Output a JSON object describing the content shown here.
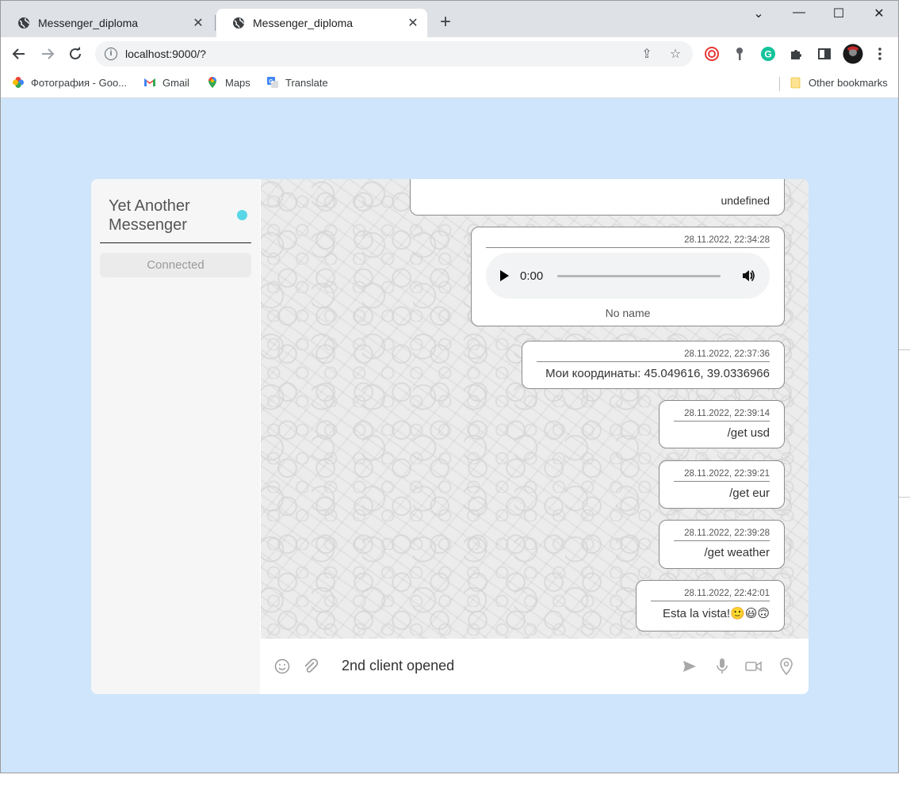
{
  "browser": {
    "tabs": [
      {
        "title": "Messenger_diploma",
        "active": false
      },
      {
        "title": "Messenger_diploma",
        "active": true
      }
    ],
    "url": "localhost:9000/?",
    "bookmarks": [
      {
        "label": "Фотография - Goo...",
        "icon": "google-photos-icon"
      },
      {
        "label": "Gmail",
        "icon": "gmail-icon"
      },
      {
        "label": "Maps",
        "icon": "maps-icon"
      },
      {
        "label": "Translate",
        "icon": "translate-icon"
      }
    ],
    "other_bookmarks": "Other bookmarks"
  },
  "sidebar": {
    "title": "Yet Another Messenger",
    "status": "Connected",
    "status_color": "#58d6e6"
  },
  "messages": [
    {
      "time": "",
      "text": "undefined",
      "partial": true
    },
    {
      "time": "28.11.2022, 22:34:28",
      "type": "audio",
      "audio_time": "0:00",
      "name": "No name"
    },
    {
      "time": "28.11.2022, 22:37:36",
      "text": "Мои координаты: 45.049616, 39.0336966"
    },
    {
      "time": "28.11.2022, 22:39:14",
      "text": "/get usd"
    },
    {
      "time": "28.11.2022, 22:39:21",
      "text": "/get eur"
    },
    {
      "time": "28.11.2022, 22:39:28",
      "text": "/get weather"
    },
    {
      "time": "28.11.2022, 22:42:01",
      "text": "Esta la vista!🙂😃🙃"
    }
  ],
  "composer": {
    "value": "2nd client opened"
  }
}
